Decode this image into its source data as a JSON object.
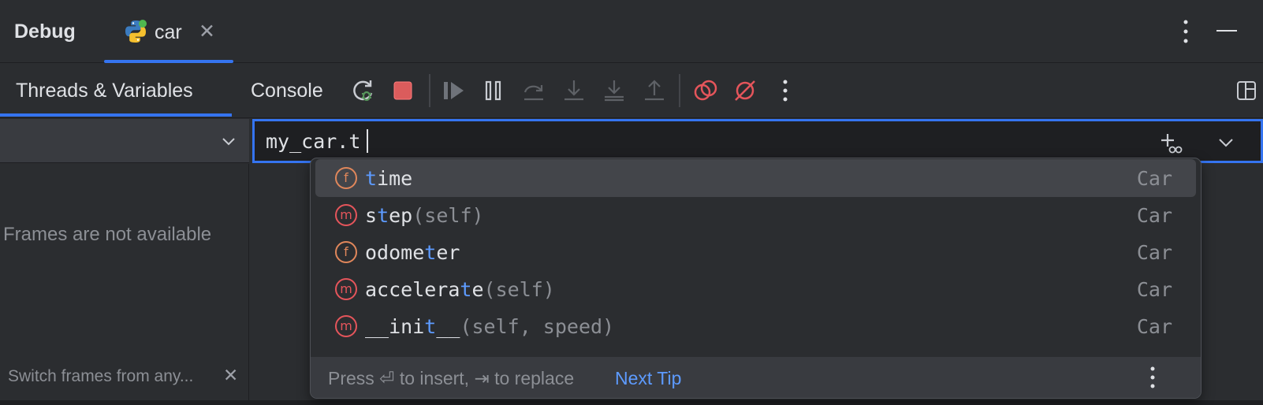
{
  "title_bar": {
    "title": "Debug",
    "run_tab_label": "car",
    "close_glyph": "✕"
  },
  "toolbar": {
    "tabs": [
      {
        "label": "Threads & Variables",
        "active": true
      },
      {
        "label": "Console",
        "active": false
      }
    ],
    "buttons": [
      "rerun-debug-icon",
      "stop-icon",
      "resume-icon",
      "pause-icon",
      "step-over-icon",
      "step-into-icon",
      "step-into-my-code-icon",
      "step-out-icon",
      "view-breakpoints-icon",
      "mute-breakpoints-icon",
      "more-icon",
      "layout-icon"
    ]
  },
  "frames": {
    "empty_text": "Frames are not available",
    "hint": "Switch frames from any...",
    "close_glyph": "✕"
  },
  "expression": {
    "value": "my_car.t"
  },
  "completion": {
    "items": [
      {
        "kind": "f",
        "before": "",
        "match": "t",
        "after": "ime",
        "params": "",
        "type": "Car",
        "selected": true
      },
      {
        "kind": "m",
        "before": "s",
        "match": "t",
        "after": "ep",
        "params": "(self)",
        "type": "Car",
        "selected": false
      },
      {
        "kind": "f",
        "before": "odome",
        "match": "t",
        "after": "er",
        "params": "",
        "type": "Car",
        "selected": false
      },
      {
        "kind": "m",
        "before": "accelera",
        "match": "t",
        "after": "e",
        "params": "(self)",
        "type": "Car",
        "selected": false
      },
      {
        "kind": "m",
        "before": "__ini",
        "match": "t",
        "after": "__",
        "params": "(self, speed)",
        "type": "Car",
        "selected": false
      }
    ],
    "footer_hint": "Press ⏎ to insert, ⇥ to replace",
    "footer_link": "Next Tip"
  },
  "colors": {
    "accent": "#3574f0",
    "field_kind": "#e0875b",
    "method_kind": "#e5555b",
    "match_highlight": "#5d9bff"
  }
}
